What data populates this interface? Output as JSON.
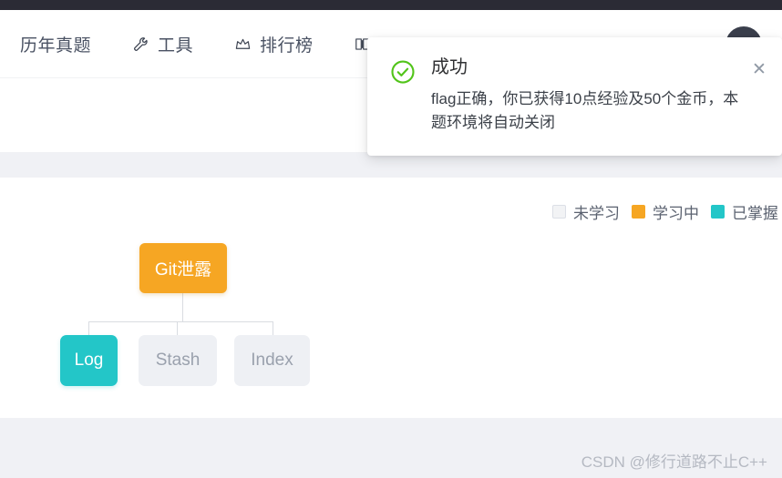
{
  "colors": {
    "top_strip": "#2b2b35",
    "accent_orange": "#f6a623",
    "accent_teal": "#23c6c8",
    "node_gray": "#eef0f4",
    "band_gray": "#f0f1f5",
    "success_green": "#52c41a"
  },
  "navbar": {
    "items": [
      {
        "label": "历年真题",
        "icon": ""
      },
      {
        "label": "工具",
        "icon": "wrench-icon"
      },
      {
        "label": "排行榜",
        "icon": "crown-icon"
      },
      {
        "label": "",
        "icon": "book-icon"
      }
    ],
    "avatar": "user-avatar"
  },
  "legend": {
    "entries": [
      {
        "label": "未学习",
        "color": "#f2f3f5",
        "style": "empty"
      },
      {
        "label": "学习中",
        "color": "#f6a623",
        "style": "filled"
      },
      {
        "label": "已掌握",
        "color": "#23c6c8",
        "style": "filled"
      }
    ]
  },
  "tree": {
    "root": {
      "label": "Git泄露",
      "state": "学习中",
      "color": "#f6a623"
    },
    "children": [
      {
        "label": "Log",
        "state": "已掌握",
        "color": "#23c6c8"
      },
      {
        "label": "Stash",
        "state": "未学习",
        "color": "#eef0f4"
      },
      {
        "label": "Index",
        "state": "未学习",
        "color": "#eef0f4"
      }
    ]
  },
  "toast": {
    "icon": "success-check-circle-icon",
    "title": "成功",
    "message": "flag正确，你已获得10点经验及50个金币，本题环境将自动关闭",
    "close_label": "✕"
  },
  "footer": {
    "watermark": "CSDN @修行道路不止C++"
  }
}
